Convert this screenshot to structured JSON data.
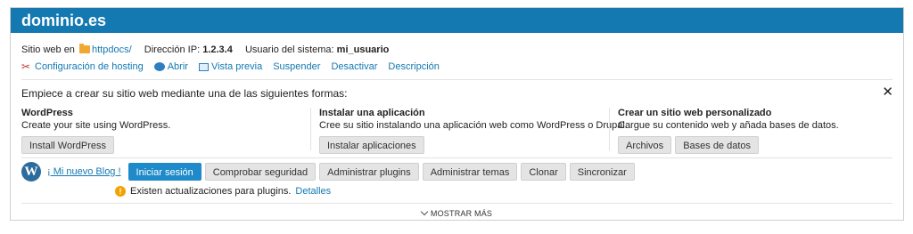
{
  "header": {
    "title": "dominio.es"
  },
  "info": {
    "website_label": "Sitio web en",
    "website_folder": "httpdocs/",
    "ip_label": "Dirección IP:",
    "ip_value": "1.2.3.4",
    "user_label": "Usuario del sistema:",
    "user_value": "mi_usuario"
  },
  "actions": [
    {
      "label": "Configuración de hosting",
      "icon": "tools-icon"
    },
    {
      "label": "Abrir",
      "icon": "open-globe-icon"
    },
    {
      "label": "Vista previa",
      "icon": "preview-icon"
    },
    {
      "label": "Suspender"
    },
    {
      "label": "Desactivar"
    },
    {
      "label": "Descripción"
    }
  ],
  "intro": {
    "text": "Empiece a crear su sitio web mediante una de las siguientes formas:",
    "close": "✕"
  },
  "columns": [
    {
      "title": "WordPress",
      "desc": "Create your site using WordPress.",
      "buttons": [
        "Install WordPress"
      ]
    },
    {
      "title": "Instalar una aplicación",
      "desc": "Cree su sitio instalando una aplicación web como WordPress o Drupal.",
      "buttons": [
        "Instalar aplicaciones"
      ]
    },
    {
      "title": "Crear un sitio web personalizado",
      "desc": "Cargue su contenido web y añada bases de datos.",
      "buttons": [
        "Archivos",
        "Bases de datos"
      ]
    }
  ],
  "wordpress": {
    "logo": "W",
    "blog_name": "¡ Mi nuevo Blog !",
    "buttons": [
      "Iniciar sesión",
      "Comprobar seguridad",
      "Administrar plugins",
      "Administrar temas",
      "Clonar",
      "Sincronizar"
    ],
    "update_text": "Existen actualizaciones para plugins.",
    "update_link": "Detalles",
    "warn_symbol": "!"
  },
  "footer": {
    "more": "MOSTRAR MÁS"
  },
  "colors": {
    "header_bg": "#1479b1",
    "link": "#1479b1",
    "primary_button": "#1e8ac9",
    "warning": "#f3a200"
  }
}
